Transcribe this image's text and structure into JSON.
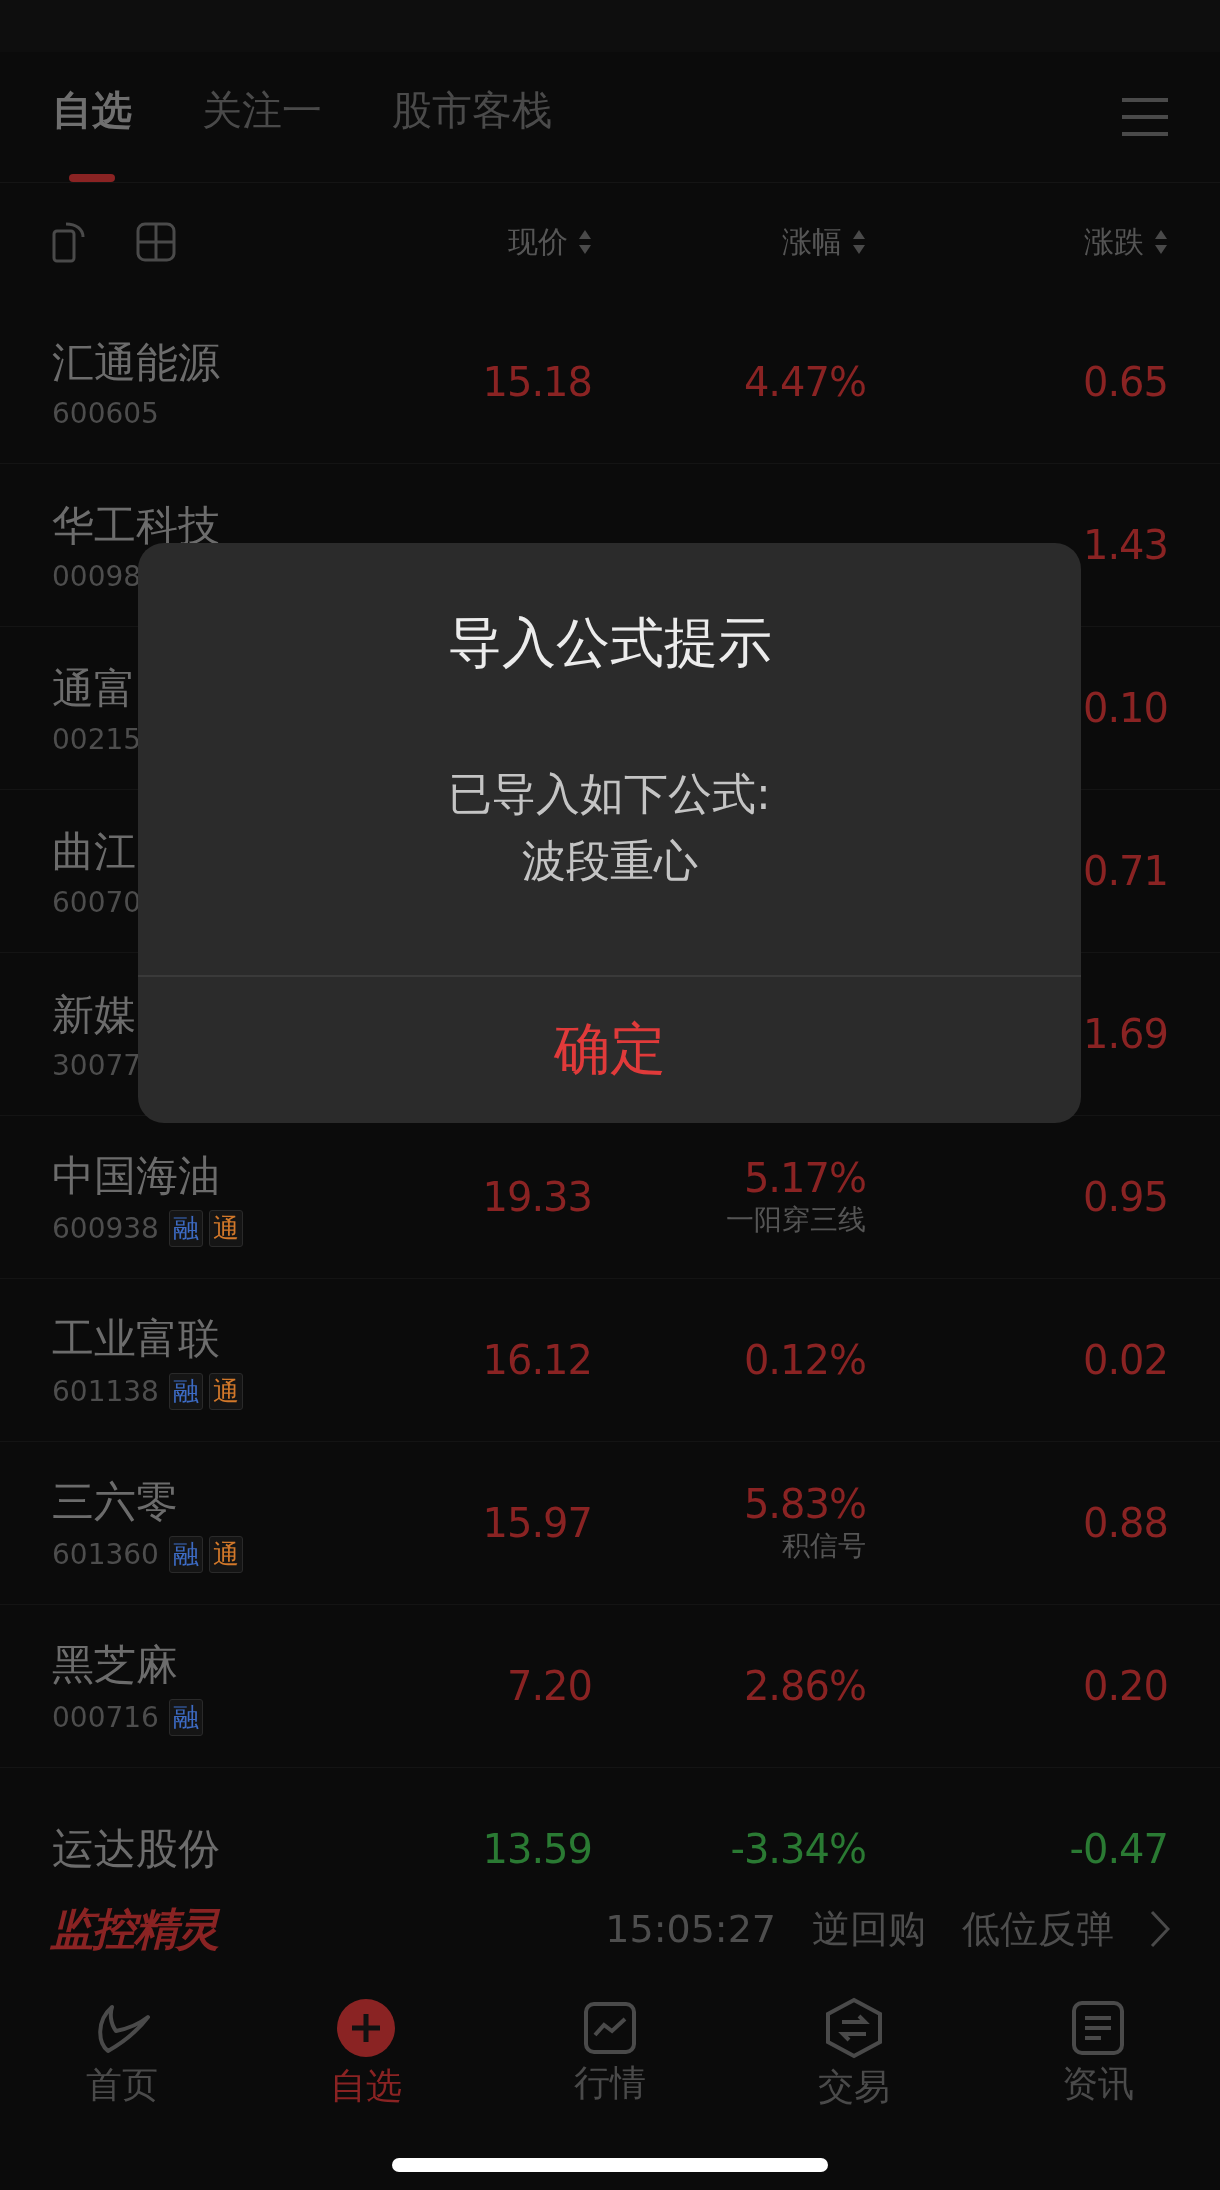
{
  "tabs": [
    {
      "label": "自选",
      "selected": true
    },
    {
      "label": "关注一",
      "selected": false
    },
    {
      "label": "股市客栈",
      "selected": false
    }
  ],
  "columns": [
    "现价",
    "涨幅",
    "涨跌"
  ],
  "rows": [
    {
      "name": "汇通能源",
      "code": "600605",
      "price": "15.18",
      "pct": "4.47%",
      "change": "0.65",
      "color": "#8a2323",
      "badges": []
    },
    {
      "name": "华工科技",
      "code": "00098",
      "change": "1.43",
      "color": "#8a2323",
      "badges": []
    },
    {
      "name": "通富",
      "code": "00215",
      "change": "0.10",
      "color": "#8a2323",
      "badges": []
    },
    {
      "name": "曲江",
      "code": "60070",
      "change": "0.71",
      "color": "#8a2323",
      "badges": []
    },
    {
      "name": "新媒",
      "code": "30077",
      "change": "1.69",
      "color": "#8a2323",
      "badges": []
    },
    {
      "name": "中国海油",
      "code": "600938",
      "price": "19.33",
      "pct": "5.17%",
      "signal": "一阳穿三线",
      "change": "0.95",
      "color": "#8a2323",
      "badges": [
        {
          "text": "融",
          "color": "#3d6bc4"
        },
        {
          "text": "通",
          "color": "#d2782a"
        }
      ]
    },
    {
      "name": "工业富联",
      "code": "601138",
      "price": "16.12",
      "pct": "0.12%",
      "change": "0.02",
      "color": "#8a2323",
      "badges": [
        {
          "text": "融",
          "color": "#3d6bc4"
        },
        {
          "text": "通",
          "color": "#d2782a"
        }
      ]
    },
    {
      "name": "三六零",
      "code": "601360",
      "price": "15.97",
      "pct": "5.83%",
      "signal": "积信号",
      "change": "0.88",
      "color": "#8a2323",
      "badges": [
        {
          "text": "融",
          "color": "#3d6bc4"
        },
        {
          "text": "通",
          "color": "#d2782a"
        }
      ]
    },
    {
      "name": "黑芝麻",
      "code": "000716",
      "price": "7.20",
      "pct": "2.86%",
      "change": "0.20",
      "color": "#8a2323",
      "badges": [
        {
          "text": "融",
          "color": "#3d6bc4"
        }
      ]
    },
    {
      "name": "运达股份",
      "price": "13.59",
      "pct": "-3.34%",
      "change": "-0.47",
      "color": "#2a7a33",
      "badges": []
    }
  ],
  "monitor": {
    "logo": "监控精灵",
    "time": "15:05:27",
    "items": [
      "逆回购",
      "低位反弹"
    ]
  },
  "nav": [
    {
      "label": "首页",
      "kind": "home",
      "selected": false
    },
    {
      "label": "自选",
      "kind": "watchlist",
      "selected": true
    },
    {
      "label": "行情",
      "kind": "market",
      "selected": false
    },
    {
      "label": "交易",
      "kind": "trade",
      "selected": false
    },
    {
      "label": "资讯",
      "kind": "news",
      "selected": false
    }
  ],
  "dialog": {
    "title": "导入公式提示",
    "body": [
      "已导入如下公式:",
      "波段重心"
    ],
    "confirm": "确定"
  }
}
